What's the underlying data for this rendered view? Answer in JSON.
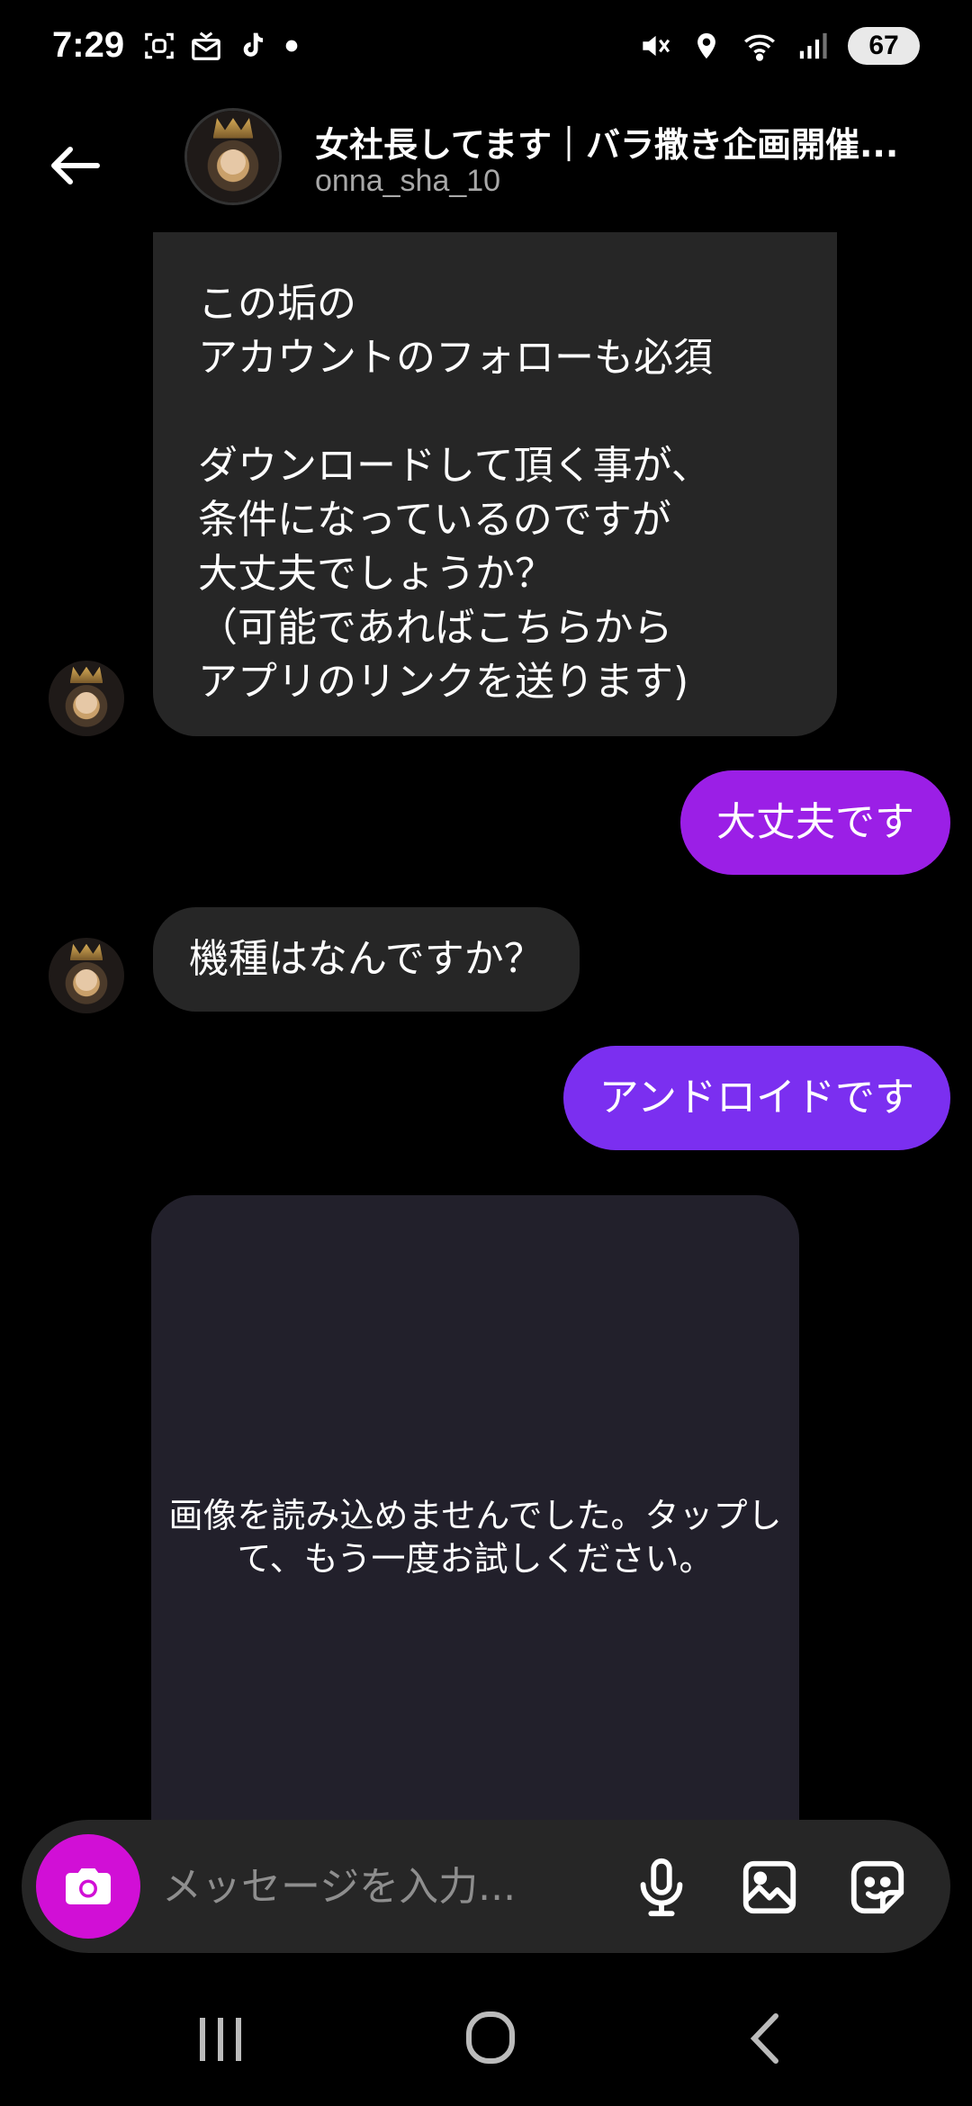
{
  "status_bar": {
    "time": "7:29",
    "battery": "67",
    "left_icons": [
      "screenshot-icon",
      "mail-icon",
      "tiktok-icon",
      "dot-icon"
    ],
    "right_icons": [
      "mute-icon",
      "location-icon",
      "wifi-icon",
      "signal-icon",
      "battery-icon"
    ]
  },
  "header": {
    "title": "女社長してます｜バラ撒き企画開催...",
    "username": "onna_sha_10"
  },
  "messages": [
    {
      "direction": "incoming",
      "text": "この垢の\nアカウントのフォローも必須\n\nダウンロードして頂く事が、\n条件になっているのですが\n大丈夫でしょうか？\n（可能であればこちらから\nアプリのリンクを送ります)"
    },
    {
      "direction": "outgoing",
      "text": "大丈夫です",
      "color": "#9b1fe6"
    },
    {
      "direction": "incoming",
      "text": "機種はなんですか？"
    },
    {
      "direction": "outgoing",
      "text": "アンドロイドです",
      "color": "#7b2ff0"
    },
    {
      "direction": "incoming",
      "type": "image",
      "text": "画像を読み込めませんでした。タップして、もう一度お試しください。"
    }
  ],
  "composer": {
    "placeholder": "メッセージを入力...",
    "camera_color": "#d10fd6"
  },
  "navbar": {
    "buttons": [
      "recent-apps",
      "home",
      "back"
    ]
  }
}
